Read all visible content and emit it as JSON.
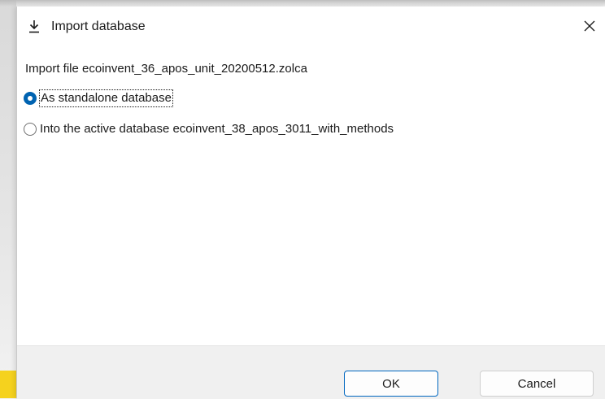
{
  "dialog": {
    "title": "Import database",
    "title_icon": "download-icon",
    "close_icon": "close-icon"
  },
  "content": {
    "import_file_label": "Import file ecoinvent_36_apos_unit_20200512.zolca",
    "options": [
      {
        "label": "As standalone database",
        "selected": true
      },
      {
        "label": "Into the active database ecoinvent_38_apos_3011_with_methods",
        "selected": false
      }
    ]
  },
  "footer": {
    "ok_label": "OK",
    "cancel_label": "Cancel"
  },
  "colors": {
    "accent": "#0063b1",
    "footer_bg": "#f0f0f0",
    "dialog_bg": "#ffffff"
  }
}
